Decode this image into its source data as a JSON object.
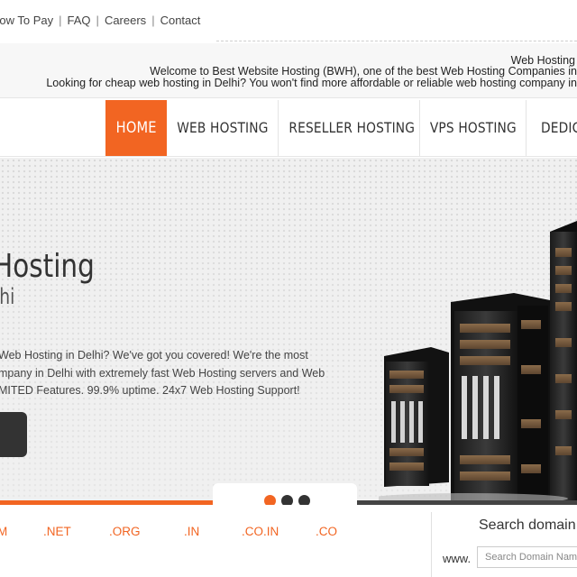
{
  "toplinks": {
    "items": [
      "How To Pay",
      "FAQ",
      "Careers",
      "Contact"
    ]
  },
  "welcome": {
    "line1": "Web Hosting",
    "line2": "Welcome to Best Website Hosting (BWH), one of the best Web Hosting Companies in",
    "line3": "Looking for cheap web hosting in Delhi? You won't find more affordable or reliable web hosting company in"
  },
  "nav": {
    "items": [
      "HOME",
      "WEB HOSTING",
      "RESELLER HOSTING",
      "VPS HOSTING",
      "DEDICA"
    ],
    "active_color": "#f26522"
  },
  "hero": {
    "title": "Hosting",
    "subtitle": "lhi",
    "description": "Web Hosting in Delhi? We've got you covered! We're the most mpany in Delhi with extremely fast Web Hosting servers and Web MITED Features. 99.9% uptime. 24x7 Web Hosting Support!"
  },
  "slider": {
    "dots": [
      "active",
      "inactive",
      "inactive"
    ],
    "accent": "#f26522"
  },
  "domains": {
    "tlds": [
      "M",
      ".NET",
      ".ORG",
      ".IN",
      ".CO.IN",
      ".CO"
    ],
    "search_title": "Search domain",
    "www_label": "www.",
    "search_placeholder": "Search Domain Nam"
  }
}
